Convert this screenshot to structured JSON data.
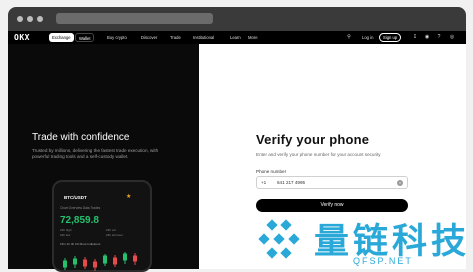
{
  "nav": {
    "logo": "OKX",
    "segments": [
      "Exchange",
      "Wallet"
    ],
    "menu": [
      "Buy crypto",
      "Discover",
      "Trade",
      "Institutional",
      "Learn",
      "More"
    ],
    "login": "Log in",
    "signup": "Sign up"
  },
  "left": {
    "title": "Trade with confidence",
    "subtitle": "Trusted by millions, delivering the fastest trade execution, with powerful trading tools and a self-custody wallet.",
    "phone": {
      "pair": "BTC/USDT",
      "tabs": "Chart    Overview    Data    Trades",
      "price": "72,859.8",
      "stat1": "24h high",
      "stat2": "24h low",
      "stat3": "24h vol",
      "stat4": "24h turnover",
      "timeframes": "15m  1h  4h  1D  More  Indicators"
    }
  },
  "right": {
    "title": "Verify your phone",
    "description": "Enter and verify your phone number for your account security",
    "label": "Phone number",
    "country_code": "+1",
    "phone_value": "641 217 4995",
    "button": "Verify now"
  },
  "watermark": {
    "text": "量链科技",
    "url": "QFSP.NET"
  },
  "colors": {
    "accent_green": "#25c06d",
    "watermark": "#2aa9d8"
  }
}
